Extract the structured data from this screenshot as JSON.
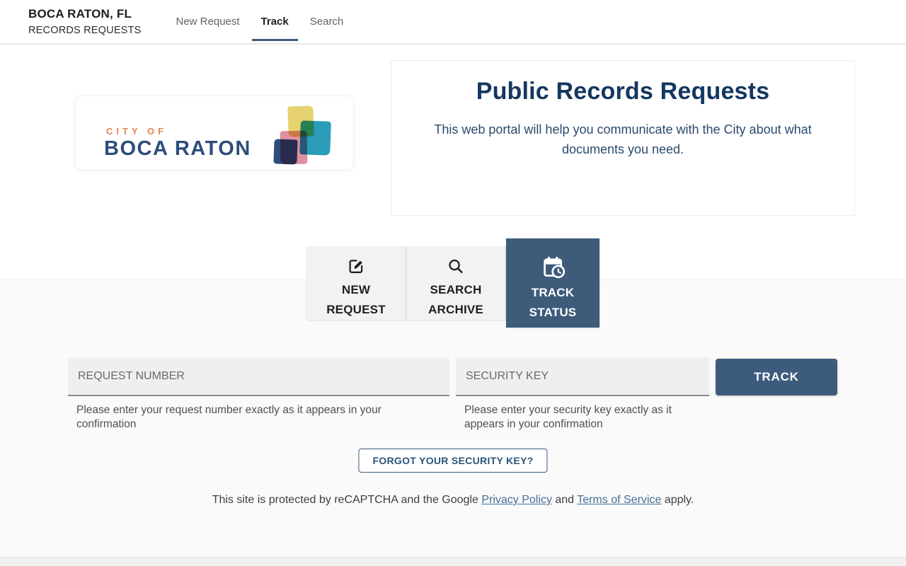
{
  "header": {
    "brand_title": "BOCA RATON, FL",
    "brand_subtitle": "RECORDS REQUESTS",
    "nav": [
      {
        "label": "New Request",
        "active": false
      },
      {
        "label": "Track",
        "active": true
      },
      {
        "label": "Search",
        "active": false
      }
    ]
  },
  "logo": {
    "eyebrow": "CITY OF",
    "name": "BOCA RATON"
  },
  "intro": {
    "title": "Public Records Requests",
    "subtitle": "This web portal will help you communicate with the City about what documents you need."
  },
  "tabs": [
    {
      "label": "NEW REQUEST",
      "icon": "edit-square-icon",
      "active": false
    },
    {
      "label": "SEARCH ARCHIVE",
      "icon": "search-icon",
      "active": false
    },
    {
      "label": "TRACK STATUS",
      "icon": "calendar-clock-icon",
      "active": true
    }
  ],
  "form": {
    "request_number": {
      "placeholder": "REQUEST NUMBER",
      "helper": "Please enter your request number exactly as it appears in your confirmation"
    },
    "security_key": {
      "placeholder": "SECURITY KEY",
      "helper": "Please enter your security key exactly as it appears in your confirmation"
    },
    "track_button": "TRACK",
    "forgot_button": "FORGOT YOUR SECURITY KEY?"
  },
  "recaptcha": {
    "prefix": "This site is protected by reCAPTCHA and the Google ",
    "privacy_link": "Privacy Policy",
    "middle": " and ",
    "terms_link": "Terms of Service",
    "suffix": " apply."
  },
  "colors": {
    "accent_navy": "#3d5b7d",
    "active_tab_navy": "#3e5c7a",
    "heading_navy": "#14375f",
    "logo_orange": "#e8854f",
    "logo_navy": "#2e4d7b",
    "logo_yellow": "#e6d26e",
    "logo_teal": "#2b9cb9",
    "logo_pink": "#e190a2"
  }
}
